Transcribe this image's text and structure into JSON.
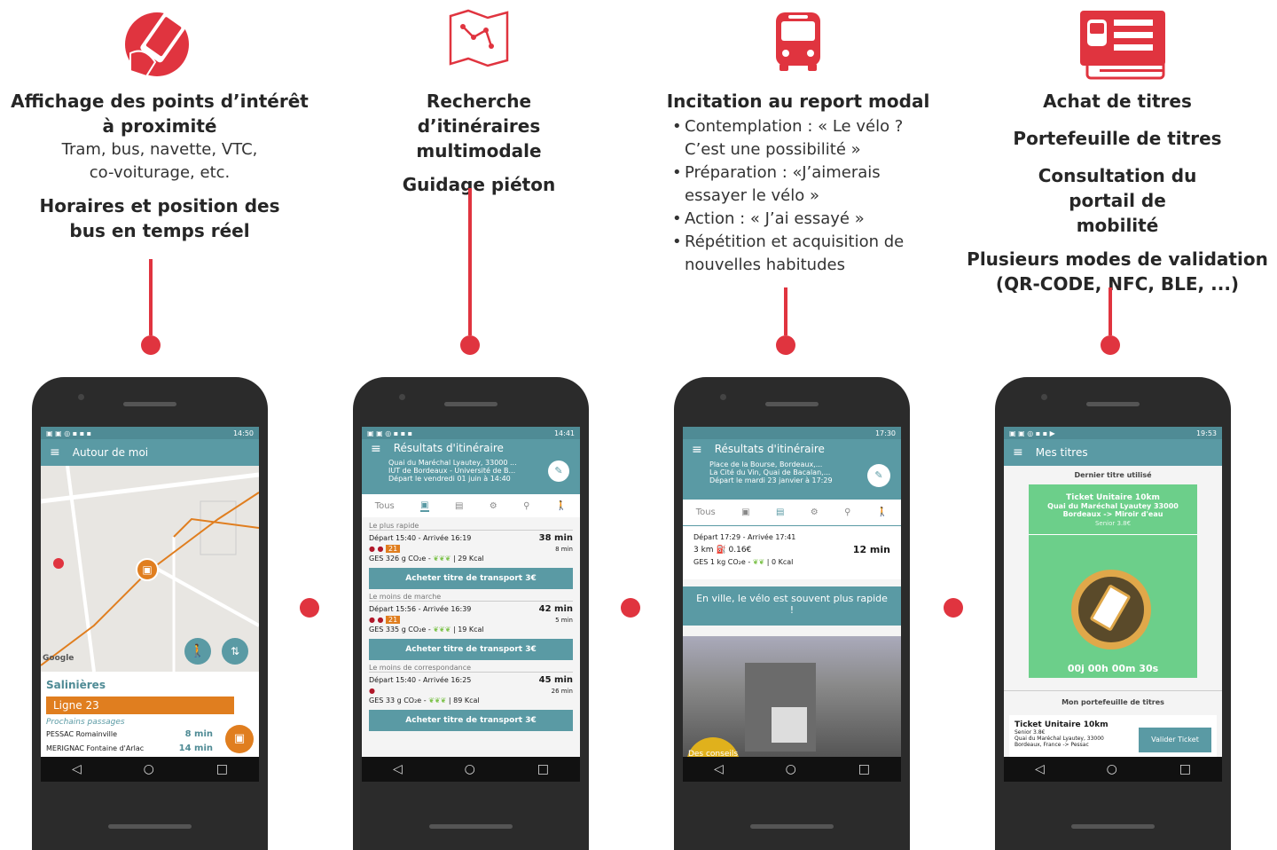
{
  "accent": "#e0343f",
  "teal": "#5a9aa4",
  "orange": "#e07e1f",
  "col1": {
    "icon": "phone-hand-icon",
    "title": "Affichage des points d’intérêt à proximité",
    "subtitle": "Tram, bus, navette, VTC, co-voiturage, etc.",
    "title2": "Horaires et position des bus en temps réel",
    "phone": {
      "status_time": "14:50",
      "app_title": "Autour de moi",
      "stop_name": "Salinières",
      "line": "Ligne 23",
      "next_label": "Prochains passages",
      "rows": [
        {
          "stop": "PESSAC Romainville",
          "time": "8 min"
        },
        {
          "stop": "MERIGNAC Fontaine d'Arlac",
          "time": "14 min"
        }
      ],
      "google": "Google"
    }
  },
  "col2": {
    "icon": "map-route-icon",
    "title": "Recherche d’itinéraires multimodale",
    "title2": "Guidage piéton",
    "phone": {
      "status_time": "14:41",
      "app_title": "Résultats d'itinéraire",
      "from": "Quai du Maréchal Lyautey, 33000 ...",
      "to": "IUT de Bordeaux - Université de B...",
      "depart": "Départ le vendredi 01 juin  à 14:40",
      "tab_all": "Tous",
      "sections": [
        {
          "label": "Le plus rapide",
          "times": "Départ 15:40 - Arrivée 16:19",
          "duration": "38  min",
          "walk": "8 min",
          "ges": "GES  326 g CO₂e -",
          "kcal": "29 Kcal",
          "buy": "Acheter titre de transport 3€"
        },
        {
          "label": "Le moins de marche",
          "times": "Départ 15:56 - Arrivée 16:39",
          "duration": "42  min",
          "walk": "5 min",
          "ges": "GES  335 g CO₂e -",
          "kcal": "19 Kcal",
          "buy": "Acheter titre de transport 3€"
        },
        {
          "label": "Le moins de correspondance",
          "times": "Départ 15:40 - Arrivée 16:25",
          "duration": "45  min",
          "walk": "26 min",
          "ges": "GES  33 g CO₂e -",
          "kcal": "89 Kcal",
          "buy": "Acheter titre de transport 3€"
        }
      ]
    }
  },
  "col3": {
    "icon": "bus-icon",
    "title": "Incitation au report modal",
    "bullets": [
      "Contemplation : « Le vélo ? C’est une possibilité »",
      "Préparation : «J’aimerais essayer le vélo »",
      "Action : « J’ai essayé »",
      "Répétition et acquisition de nouvelles habitudes"
    ],
    "phone": {
      "status_time": "17:30",
      "app_title": "Résultats d'itinéraire",
      "from": "Place de la Bourse, Bordeaux,...",
      "to": "La Cité du Vin, Quai de Bacalan,...",
      "depart": "Départ le mardi 23 janvier  à 17:29",
      "tab_all": "Tous",
      "times": "Départ 17:29  - Arrivée 17:41",
      "dist": "3 km",
      "cost": "0.16€",
      "duration": "12 min",
      "ges": "GES  1 kg  CO₂e -",
      "kcal": "0 Kcal",
      "banner": "En ville, le vélo est souvent plus rapide !",
      "advice": "Des conseils mobilité"
    }
  },
  "col4": {
    "icon": "ticket-card-icon",
    "title": "Achat de titres",
    "title2": "Portefeuille de titres",
    "title3": "Consultation du portail de mobilité",
    "title4": "Plusieurs modes de validation (QR-CODE, NFC, BLE, ...)",
    "phone": {
      "status_time": "19:53",
      "app_title": "Mes titres",
      "last_label": "Dernier titre utilisé",
      "ticket_name": "Ticket Unitaire 10km",
      "ticket_route": "Quai du Maréchal Lyautey 33000 Bordeaux -> Miroir d'eau",
      "ticket_price": "Senior 3.8€",
      "timer": "00j 00h 00m 30s",
      "wallet_label": "Mon portefeuille de titres",
      "wallet_ticket": "Ticket Unitaire 10km",
      "wallet_price": "Senior 3.8€",
      "wallet_route": "Quai du Maréchal Lyautey, 33000 Bordeaux, France -> Pessac",
      "validate": "Valider Ticket"
    }
  }
}
